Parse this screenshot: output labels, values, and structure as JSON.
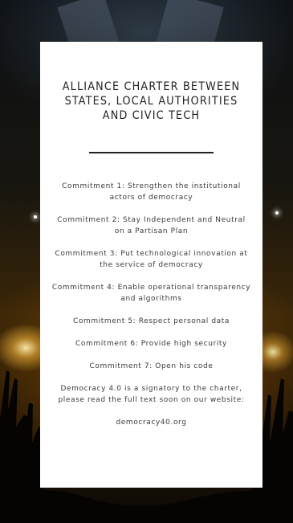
{
  "card": {
    "title": "ALLIANCE CHARTER BETWEEN\nSTATES, LOCAL AUTHORITIES\nAND CIVIC TECH",
    "commitments": [
      "Commitment 1: Strengthen the institutional actors of democracy",
      "Commitment 2: Stay Independent and Neutral on a Partisan Plan",
      "Commitment 3: Put technological innovation at the service of democracy",
      "Commitment 4: Enable operational transparency and algorithms",
      "Commitment 5: Respect personal data",
      "Commitment 6: Provide high security",
      "Commitment 7: Open his code"
    ],
    "note": "Democracy 4.0 is a signatory to the charter, please read the full text soon on our website:",
    "website": "democracy40.org"
  },
  "colors": {
    "card_background": "#ffffff",
    "text": "#3a3a3a",
    "stage_light": "#ffbe3c"
  }
}
